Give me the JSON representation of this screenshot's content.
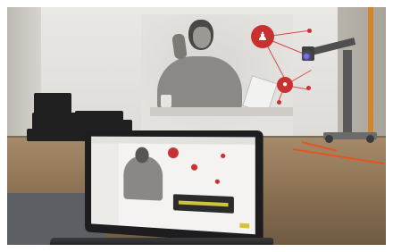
{
  "scene": {
    "description_label": "",
    "colors": {
      "accent_red": "#c8312f",
      "cable_orange": "#e2571f",
      "door_orange": "#d4862e",
      "robot_light_violet": "#7a6cff",
      "screen_yellow": "#d2c43a"
    },
    "mural": {
      "node_big_icon": "people-group-icon",
      "node_mid_icon": "car-icon"
    }
  }
}
